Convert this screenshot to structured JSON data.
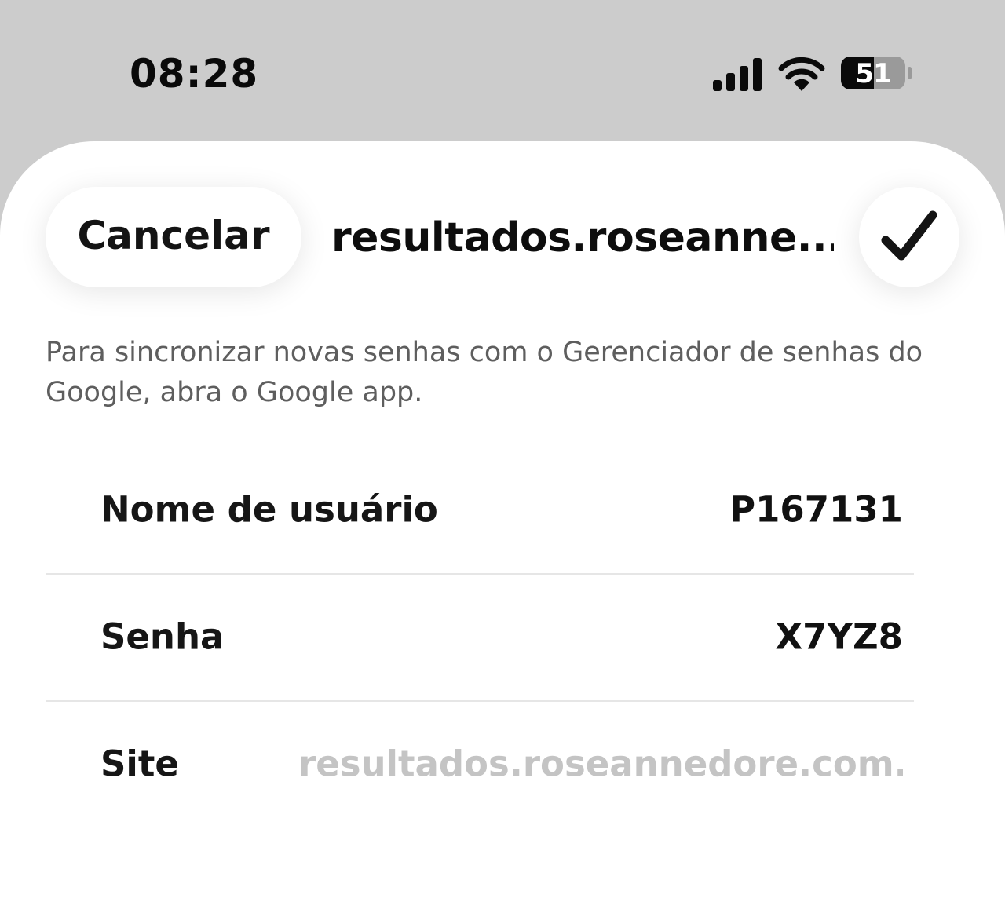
{
  "status_bar": {
    "time": "08:28",
    "battery_level": "51",
    "icons": [
      "signal-icon",
      "wifi-icon",
      "battery-icon"
    ]
  },
  "sheet": {
    "cancel_label": "Cancelar",
    "title": "resultados.roseanne...",
    "confirm_icon": "checkmark-icon",
    "info": "Para sincronizar novas senhas com o Gerenciador de senhas do Google, abra o Google app."
  },
  "fields": {
    "username": {
      "label": "Nome de usuário",
      "value": "P167131"
    },
    "password": {
      "label": "Senha",
      "value": "X7YZ8"
    },
    "site": {
      "label": "Site",
      "value": "resultados.roseannedore.com...."
    }
  },
  "colors": {
    "status_bar_bg": "#cccccc",
    "sheet_bg": "#ffffff",
    "muted_text": "#c4c4c4",
    "secondary_text": "#5e5e5e"
  }
}
